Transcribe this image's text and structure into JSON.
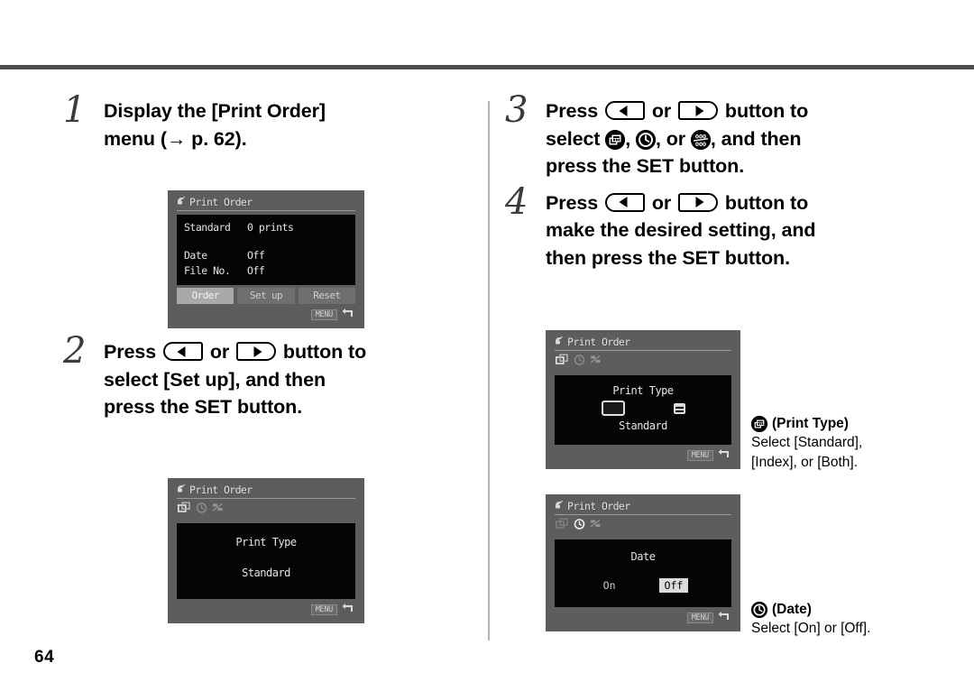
{
  "page": {
    "number": "64"
  },
  "steps": [
    {
      "num": "1",
      "segments": [
        {
          "t": "text",
          "v": "Display the [Print Order] menu (→ p. 62)."
        }
      ]
    },
    {
      "num": "2",
      "segments": [
        {
          "t": "text",
          "v": "Press "
        },
        {
          "t": "key",
          "v": "left-arrow-button"
        },
        {
          "t": "text",
          "v": " or "
        },
        {
          "t": "key",
          "v": "right-arrow-button"
        },
        {
          "t": "text",
          "v": " button to select [Set up], and then press the SET button."
        }
      ]
    },
    {
      "num": "3",
      "segments": [
        {
          "t": "text",
          "v": "Press "
        },
        {
          "t": "key",
          "v": "left-arrow-button"
        },
        {
          "t": "text",
          "v": " or "
        },
        {
          "t": "key",
          "v": "right-arrow-button"
        },
        {
          "t": "text",
          "v": " button to select "
        },
        {
          "t": "icon",
          "v": "print-type-icon"
        },
        {
          "t": "text",
          "v": ", "
        },
        {
          "t": "icon",
          "v": "date-clock-icon"
        },
        {
          "t": "text",
          "v": ", or "
        },
        {
          "t": "icon",
          "v": "file-number-icon"
        },
        {
          "t": "text",
          "v": ", and then press the SET button."
        }
      ]
    },
    {
      "num": "4",
      "segments": [
        {
          "t": "text",
          "v": "Press "
        },
        {
          "t": "key",
          "v": "left-arrow-button"
        },
        {
          "t": "text",
          "v": " or "
        },
        {
          "t": "key",
          "v": "right-arrow-button"
        },
        {
          "t": "text",
          "v": " button to make the desired setting, and then press the SET button."
        }
      ]
    }
  ],
  "step_text": {
    "s1_a": "Display the [Print Order]",
    "s1_b": "menu (",
    "s1_arrow": "→",
    "s1_c": " p. 62).",
    "s2_press": "Press",
    "s2_or": "or",
    "s2_to": "button to",
    "s2_l2": "select [Set up], and then",
    "s2_l3": "press the SET button.",
    "s3_press": "Press",
    "s3_or": "or",
    "s3_to": "button to",
    "s3_select": "select",
    "s3_comma1": ",",
    "s3_comma2": ", or",
    "s3_andthen": ", and then",
    "s3_l3": "press the SET button.",
    "s4_press": "Press",
    "s4_or": "or",
    "s4_to": "button to",
    "s4_l2": "make the desired setting, and",
    "s4_l3": "then press the SET button."
  },
  "lcd1": {
    "title": "Print Order",
    "rows": [
      {
        "key": "Standard",
        "value": "0 prints"
      },
      {
        "key": "Date",
        "value": "Off"
      },
      {
        "key": "File No.",
        "value": "Off"
      }
    ],
    "softkeys": [
      {
        "label": "Order",
        "selected": true
      },
      {
        "label": "Set up",
        "selected": false
      },
      {
        "label": "Reset",
        "selected": false
      }
    ],
    "menu_chip": "MENU"
  },
  "lcd2": {
    "title": "Print Order",
    "active_tab": 0,
    "heading": "Print Type",
    "value": "Standard",
    "menu_chip": "MENU"
  },
  "lcd3": {
    "title": "Print Order",
    "active_tab": 0,
    "heading": "Print Type",
    "value": "Standard",
    "menu_chip": "MENU"
  },
  "lcd4": {
    "title": "Print Order",
    "active_tab": 1,
    "heading": "Date",
    "options": [
      {
        "label": "On",
        "selected": false
      },
      {
        "label": "Off",
        "selected": true
      }
    ],
    "menu_chip": "MENU"
  },
  "captions": [
    {
      "icon": "print-type-icon",
      "header": "(Print Type)",
      "line1": "Select [Standard],",
      "line2": "[Index], or [Both]."
    },
    {
      "icon": "date-clock-icon",
      "header": "(Date)",
      "line1": "Select [On] or [Off].",
      "line2": ""
    }
  ],
  "colors": {
    "rule": "#4d4d4d",
    "divider": "#b3b3b3",
    "lcd_bezel": "#5d5d5d",
    "lcd_screen": "#050505",
    "lcd_text": "#e4e4e4",
    "softkey_selected": "#a9a9a9"
  }
}
